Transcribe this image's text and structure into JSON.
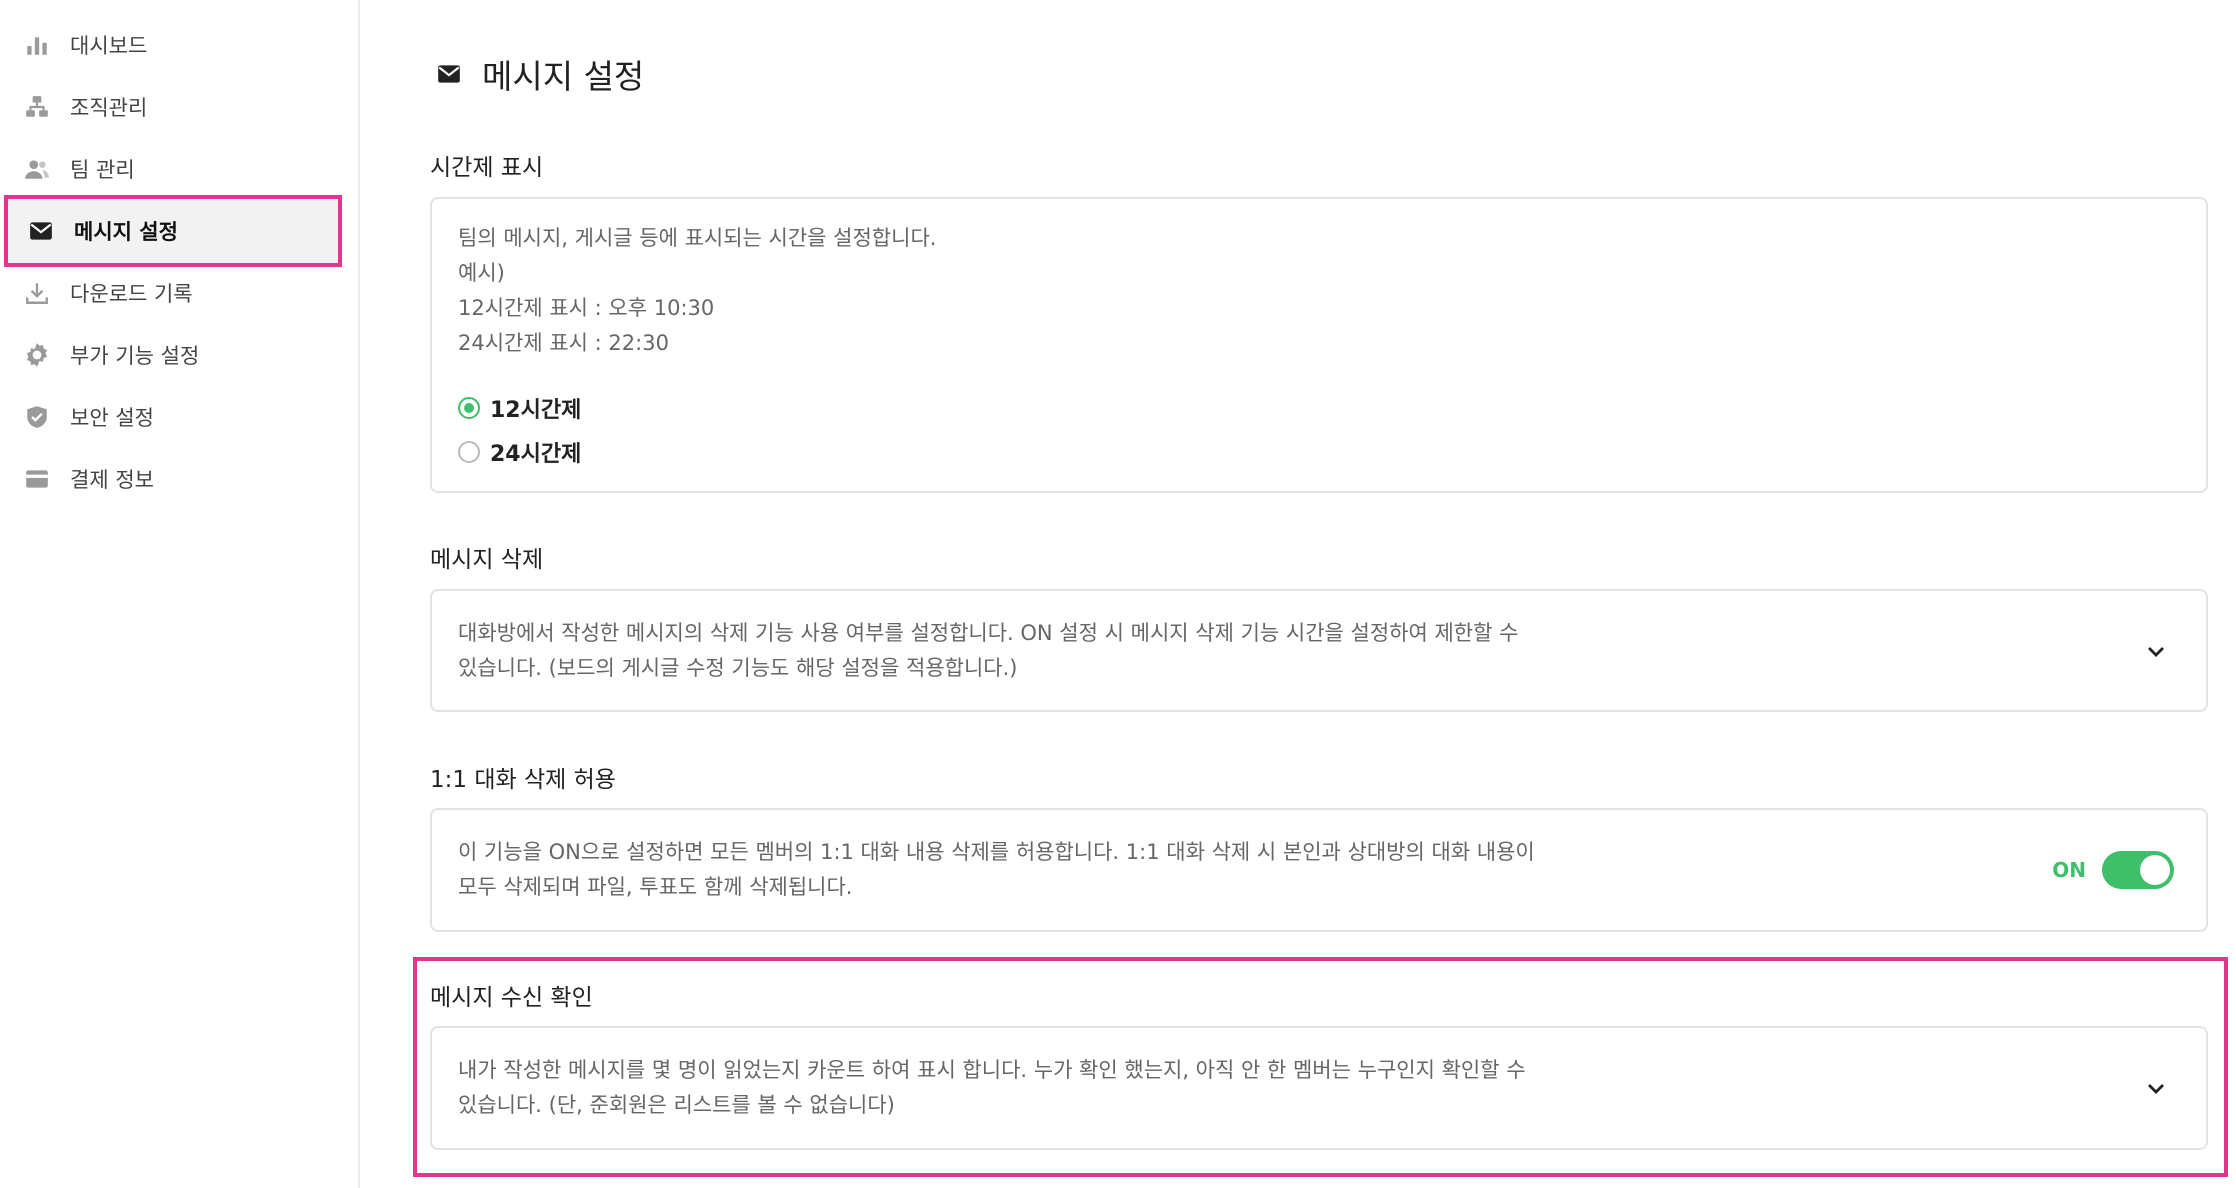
{
  "sidebar": {
    "items": [
      {
        "label": "대시보드",
        "icon": "bar-chart-icon"
      },
      {
        "label": "조직관리",
        "icon": "org-chart-icon"
      },
      {
        "label": "팀 관리",
        "icon": "people-icon"
      },
      {
        "label": "메시지 설정",
        "icon": "envelope-icon",
        "active": true
      },
      {
        "label": "다운로드 기록",
        "icon": "download-icon"
      },
      {
        "label": "부가 기능 설정",
        "icon": "gear-icon"
      },
      {
        "label": "보안 설정",
        "icon": "shield-icon"
      },
      {
        "label": "결제 정보",
        "icon": "credit-card-icon"
      }
    ]
  },
  "page": {
    "title": "메시지 설정",
    "title_icon": "envelope-icon"
  },
  "sections": {
    "time_format": {
      "label": "시간제 표시",
      "desc_lines": [
        "팀의 메시지, 게시글 등에 표시되는 시간을 설정합니다.",
        "예시)",
        "12시간제 표시 : 오후 10:30",
        "24시간제 표시 : 22:30"
      ],
      "options": [
        "12시간제",
        "24시간제"
      ],
      "selected": "12시간제"
    },
    "message_delete": {
      "label": "메시지 삭제",
      "desc_lines": [
        "대화방에서 작성한 메시지의 삭제 기능 사용 여부를 설정합니다. ON 설정 시 메시지 삭제 기능 시간을 설정하여 제한할 수",
        "있습니다. (보드의 게시글 수정 기능도 해당 설정을 적용합니다.)"
      ]
    },
    "dm_delete": {
      "label": "1:1 대화 삭제 허용",
      "desc_lines": [
        "이 기능을 ON으로 설정하면 모든 멤버의 1:1 대화 내용 삭제를 허용합니다. 1:1 대화 삭제 시 본인과 상대방의 대화 내용이",
        "모두 삭제되며 파일, 투표도 함께 삭제됩니다."
      ],
      "toggle_label": "ON",
      "toggle_on": true
    },
    "read_receipt": {
      "label": "메시지 수신 확인",
      "desc_lines": [
        "내가 작성한 메시지를 몇 명이 읽었는지 카운트 하여 표시 합니다. 누가 확인 했는지, 아직 안 한 멤버는 누구인지 확인할 수",
        "있습니다. (단, 준회원은 리스트를 볼 수 없습니다)"
      ]
    }
  },
  "colors": {
    "accent_green": "#3fbf6a",
    "highlight_pink": "#e0368f"
  }
}
